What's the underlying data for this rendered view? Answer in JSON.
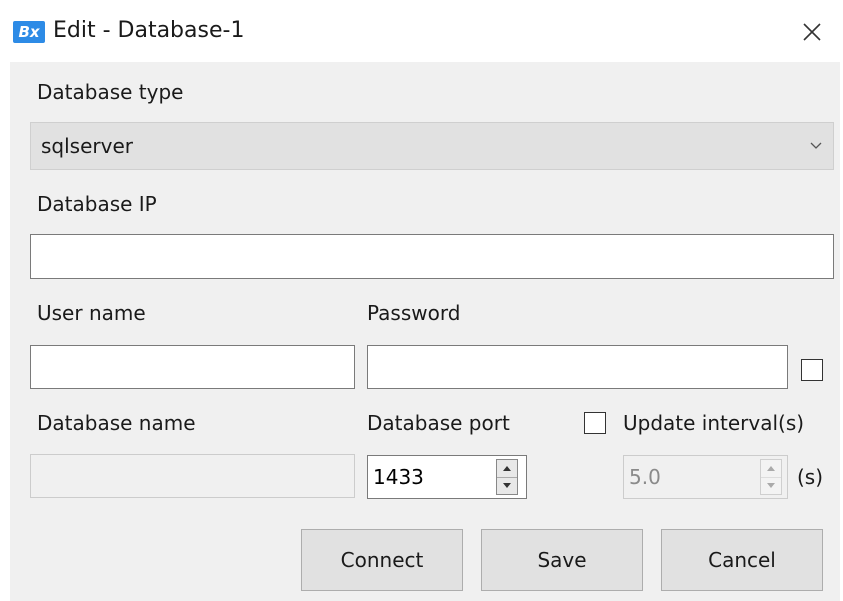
{
  "window": {
    "title": "Edit - Database-1",
    "icon_label": "Bx"
  },
  "form": {
    "database_type": {
      "label": "Database type",
      "value": "sqlserver"
    },
    "database_ip": {
      "label": "Database IP",
      "value": ""
    },
    "user_name": {
      "label": "User name",
      "value": ""
    },
    "password": {
      "label": "Password",
      "value": "",
      "show_checked": false
    },
    "database_name": {
      "label": "Database name",
      "value": ""
    },
    "database_port": {
      "label": "Database port",
      "value": "1433"
    },
    "update_interval": {
      "label": "Update interval(s)",
      "checked": false,
      "value": "5.0",
      "unit": "(s)"
    }
  },
  "buttons": {
    "connect": "Connect",
    "save": "Save",
    "cancel": "Cancel"
  },
  "colors": {
    "body_bg": "#f0f0f0",
    "combo_bg": "#e1e1e1",
    "button_bg": "#e1e1e1",
    "icon_bg": "#2d8be6"
  },
  "icons": [
    "app-logo-icon",
    "close-icon",
    "chevron-down-icon",
    "spin-up-icon",
    "spin-down-icon"
  ]
}
